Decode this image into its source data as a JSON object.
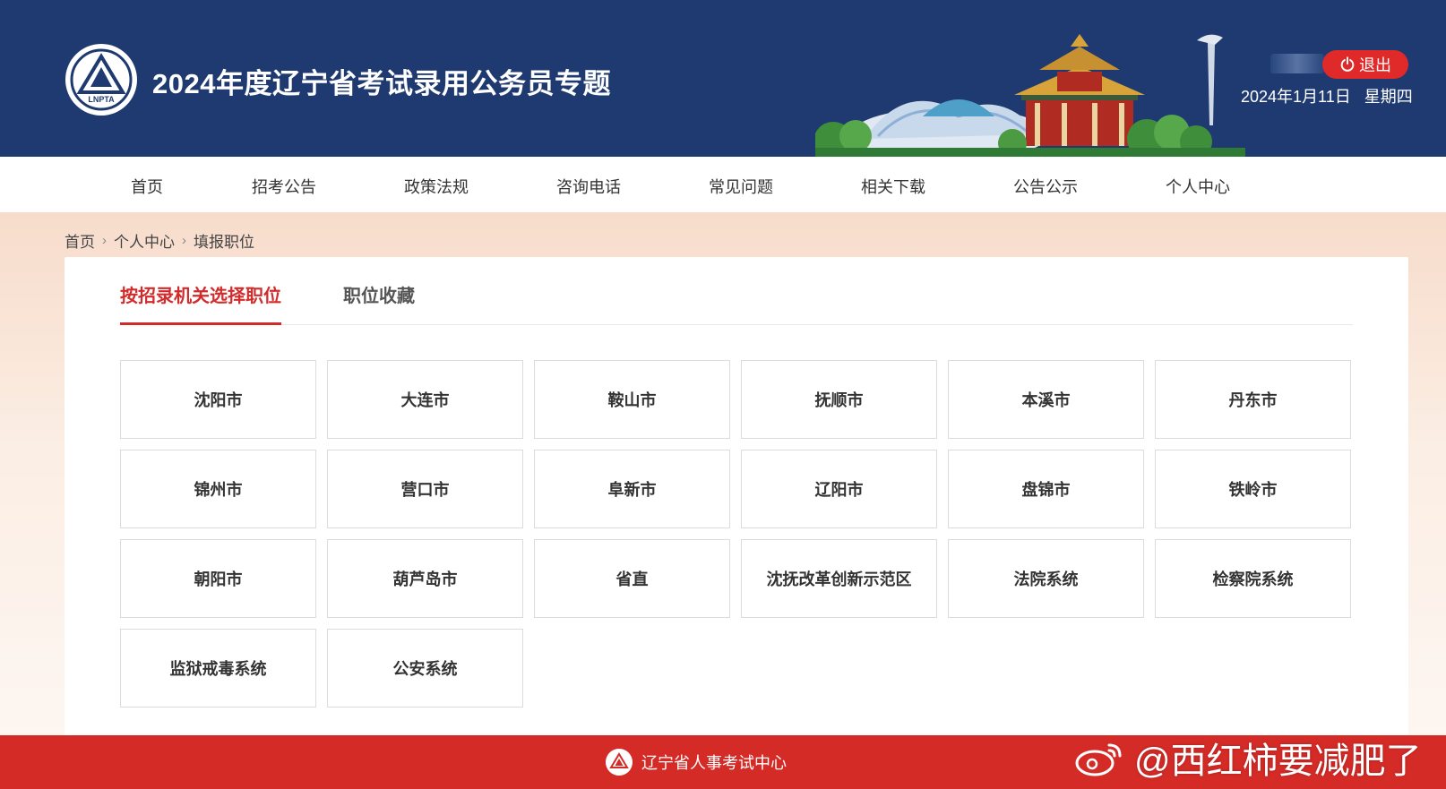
{
  "header": {
    "logo_text": "LNPTA",
    "title": "2024年度辽宁省考试录用公务员专题",
    "logout_label": "退出",
    "date": "2024年1月11日",
    "weekday": "星期四"
  },
  "nav": {
    "items": [
      "首页",
      "招考公告",
      "政策法规",
      "咨询电话",
      "常见问题",
      "相关下载",
      "公告公示",
      "个人中心"
    ]
  },
  "breadcrumb": {
    "items": [
      "首页",
      "个人中心",
      "填报职位"
    ],
    "separator": "›"
  },
  "tabs": {
    "active": "按招录机关选择职位",
    "inactive": "职位收藏"
  },
  "regions": [
    "沈阳市",
    "大连市",
    "鞍山市",
    "抚顺市",
    "本溪市",
    "丹东市",
    "锦州市",
    "营口市",
    "阜新市",
    "辽阳市",
    "盘锦市",
    "铁岭市",
    "朝阳市",
    "葫芦岛市",
    "省直",
    "沈抚改革创新示范区",
    "法院系统",
    "检察院系统",
    "监狱戒毒系统",
    "公安系统"
  ],
  "footer": {
    "org_name": "辽宁省人事考试中心"
  },
  "watermark": {
    "text": "@西红柿要减肥了",
    "icon": "weibo-icon"
  },
  "colors": {
    "header_bg": "#1f3a70",
    "accent_red": "#d22b2b",
    "footer_bg": "#d52b27",
    "logout_bg": "#e02a2a"
  }
}
